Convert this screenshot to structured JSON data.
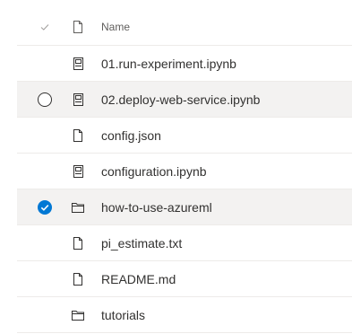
{
  "header": {
    "name_label": "Name"
  },
  "colors": {
    "accent": "#0078d4",
    "row_hover": "#f3f2f1",
    "divider": "#edebe9"
  },
  "files": [
    {
      "name": "01.run-experiment.ipynb",
      "icon": "notebook-icon",
      "state": "none"
    },
    {
      "name": "02.deploy-web-service.ipynb",
      "icon": "notebook-icon",
      "state": "hover"
    },
    {
      "name": "config.json",
      "icon": "file-icon",
      "state": "none"
    },
    {
      "name": "configuration.ipynb",
      "icon": "notebook-icon",
      "state": "none"
    },
    {
      "name": "how-to-use-azureml",
      "icon": "folder-icon",
      "state": "selected"
    },
    {
      "name": "pi_estimate.txt",
      "icon": "file-icon",
      "state": "none"
    },
    {
      "name": "README.md",
      "icon": "file-icon",
      "state": "none"
    },
    {
      "name": "tutorials",
      "icon": "folder-icon",
      "state": "none"
    }
  ]
}
